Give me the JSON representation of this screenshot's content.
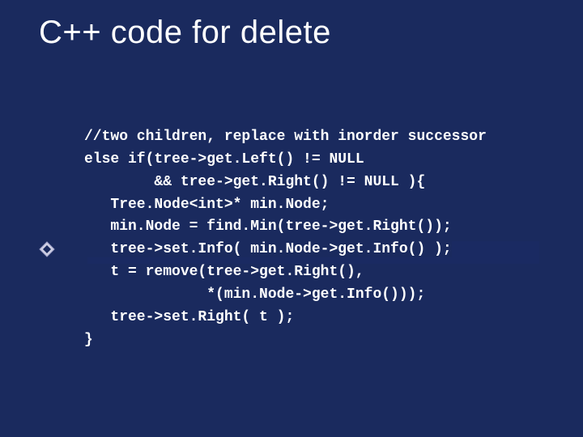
{
  "slide": {
    "title": "C++ code for delete",
    "code": {
      "l0": "//two children, replace with inorder successor",
      "l1": "else if(tree->get.Left() != NULL",
      "l2": "        && tree->get.Right() != NULL ){",
      "l3": "   Tree.Node<int>* min.Node;",
      "l4": "   min.Node = find.Min(tree->get.Right());",
      "l5": "   tree->set.Info( min.Node->get.Info() );",
      "l6": "   t = remove(tree->get.Right(),",
      "l7": "              *(min.Node->get.Info()));",
      "l8": "   tree->set.Right( t );",
      "l9": "}"
    },
    "marker_icon": "pointer-diamond"
  }
}
